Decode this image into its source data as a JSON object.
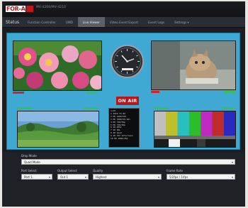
{
  "header": {
    "logo_text": "FOR-A",
    "model_text": "MV-4200/MV-4210"
  },
  "nav": {
    "tabs": [
      {
        "label": "Status",
        "active": false
      },
      {
        "label": "Function Controller",
        "active": false
      },
      {
        "label": "UMD",
        "active": false
      },
      {
        "label": "Live Viewer",
        "active": true
      },
      {
        "label": "Video Event Export",
        "active": false
      },
      {
        "label": "Event Logs",
        "active": false
      },
      {
        "label": "Settings ▾",
        "active": false
      }
    ]
  },
  "stage": {
    "on_air_label": "ON AIR",
    "channel_list_rows": [
      "      1/10",
      "1  2019 TS 80",
      "2  HD 1080/50i",
      "3  HD 1080/59.94i",
      "4  HD 720/59p",
      "5  HD 720/50p",
      "6  SD NTSC",
      "7  SD PAL",
      "8  4K Quad",
      "9  4K 2SI Interlace",
      "10 HD 1080/25p"
    ],
    "colors": {
      "background": "#3fa8d3",
      "tally_green": "#34c15a",
      "tally_red": "#d2242a",
      "on_air_red": "#b6181d"
    }
  },
  "controls": {
    "drop_mode_label": "Drop Mode",
    "drop_mode_value": "Quad Mode",
    "port_select_label": "Port Select",
    "port_select_value": "Port 1",
    "output_select_label": "Output Select",
    "output_select_value": "Out 1",
    "quality_label": "Quality",
    "quality_value": "Highest",
    "frame_rate_label": "Frame Rate",
    "frame_rate_value": "5/2fps / 1/fps"
  }
}
